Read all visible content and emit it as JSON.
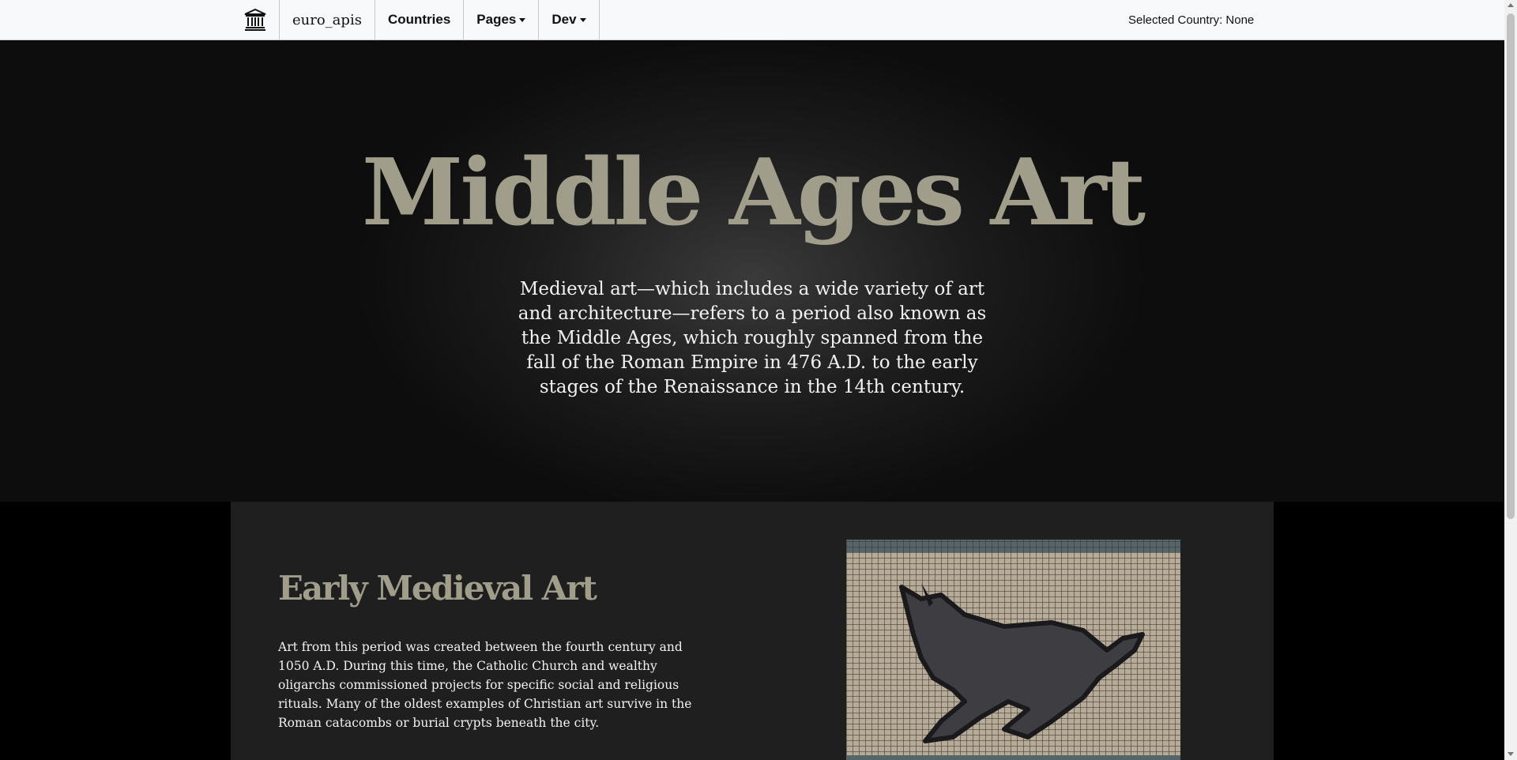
{
  "nav": {
    "brand": "euro_apis",
    "items": [
      {
        "label": "Countries",
        "dropdown": false
      },
      {
        "label": "Pages",
        "dropdown": true
      },
      {
        "label": "Dev",
        "dropdown": true
      }
    ],
    "selected_country": "Selected Country: None",
    "logo_icon": "museum-icon"
  },
  "hero": {
    "title": "Middle Ages Art",
    "description": "Medieval art—which includes a wide variety of art and architecture—refers to a period also known as the Middle Ages, which roughly spanned from the fall of the Roman Empire in 476 A.D. to the early stages of the Renaissance in the 14th century."
  },
  "section": {
    "title": "Early Medieval Art",
    "text": "Art from this period was created between the fourth century and 1050 A.D. During this time, the Catholic Church and wealthy oligarchs commissioned projects for specific social and religious rituals. Many of the oldest examples of Christian art survive in the Roman catacombs or burial crypts beneath the city.",
    "image_subject": "mosaic-of-running-animal"
  },
  "colors": {
    "accent_gold": "#a19d8b",
    "navbar_bg": "#f8f9fa",
    "section_bg": "#1f1f1f"
  }
}
